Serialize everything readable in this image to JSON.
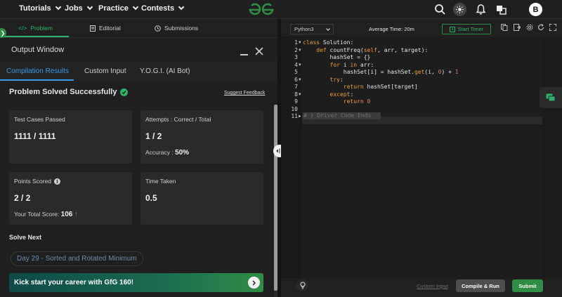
{
  "nav": {
    "items": [
      {
        "label": "Tutorials",
        "icon": "chevron-down-icon"
      },
      {
        "label": "Jobs",
        "icon": "chevron-down-icon"
      },
      {
        "label": "Practice",
        "icon": "chevron-down-icon"
      },
      {
        "label": "Contests",
        "icon": "chevron-down-icon"
      }
    ],
    "logo": "gfg-logo",
    "icons": [
      "search-icon",
      "theme-toggle-icon",
      "bell-icon",
      "translate-icon"
    ],
    "avatar_initial": "B"
  },
  "problem_tabs": [
    {
      "label": "Problem",
      "icon": "code-icon",
      "active": true
    },
    {
      "label": "Editorial",
      "icon": "document-icon",
      "active": false
    },
    {
      "label": "Submissions",
      "icon": "clock-icon",
      "active": false
    }
  ],
  "output_window": {
    "title": "Output Window",
    "tabs": [
      {
        "label": "Compilation Results",
        "active": true
      },
      {
        "label": "Custom Input",
        "active": false
      },
      {
        "label": "Y.O.G.I. (AI Bot)",
        "active": false
      }
    ],
    "status": "Problem Solved Successfully",
    "suggest_feedback": "Suggest Feedback",
    "cards": {
      "test_cases": {
        "label": "Test Cases Passed",
        "value": "1111 / 1111"
      },
      "attempts": {
        "label": "Attempts : Correct / Total",
        "value": "1 / 2",
        "accuracy_label": "Accuracy :",
        "accuracy_value": "50%"
      },
      "points": {
        "label": "Points Scored",
        "value": "2 / 2",
        "total_label": "Your Total Score:",
        "total_value": "106"
      },
      "time": {
        "label": "Time Taken",
        "value": "0.5"
      }
    },
    "solve_next": {
      "heading": "Solve Next",
      "problem": "Day 29 - Sorted and Rotated Minimum"
    },
    "banner": {
      "text": "Kick start your career with GfG 160!"
    }
  },
  "editor": {
    "language": "Python3",
    "average_time": "Average Time: 20m",
    "start_timer": "Start Timer",
    "code_lines": [
      "1",
      "2",
      "3",
      "4",
      "5",
      "6",
      "7",
      "8",
      "9",
      "10",
      "11"
    ],
    "ghost_text": "# } Driver Code Ends",
    "custom_input": "Custom Input",
    "compile_run": "Compile & Run",
    "submit": "Submit"
  },
  "colors": {
    "brand_green": "#2f8d46",
    "accent_blue": "#3a9be8",
    "keyword_orange": "#ee9b3a",
    "number_red": "#e07c6a"
  }
}
